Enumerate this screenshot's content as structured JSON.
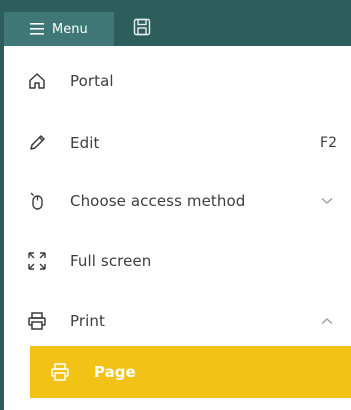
{
  "toolbar": {
    "menu_label": "Menu",
    "save_icon": "floppy-disk-icon"
  },
  "menu": {
    "items": [
      {
        "label": "Portal",
        "icon": "home-icon",
        "shortcut": ""
      },
      {
        "label": "Edit",
        "icon": "pencil-icon",
        "shortcut": "F2"
      },
      {
        "label": "Choose access method",
        "icon": "mouse-icon",
        "chevron": "down"
      },
      {
        "label": "Full screen",
        "icon": "fullscreen-icon"
      },
      {
        "label": "Print",
        "icon": "printer-icon",
        "chevron": "up"
      }
    ],
    "submenu": [
      {
        "label": "Page",
        "icon": "printer-icon"
      }
    ]
  },
  "colors": {
    "toolbar_bg": "#2e5e5c",
    "menu_tab_bg": "#3e7775",
    "highlight_bg": "#f2c316",
    "text": "#3d3d3d"
  }
}
